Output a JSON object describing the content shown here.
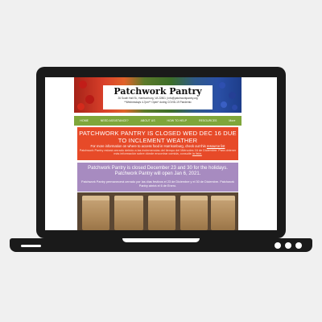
{
  "site": {
    "name": "Patchwork Pantry",
    "address_line": "26 South Hall St., Harrisonburg, VA 22801  |  info@patchworkpantry.org",
    "hours_line": "**Wednesdays 4-7pm**  Open* during COVID-19 Pandemic"
  },
  "nav": {
    "items": [
      "HOME",
      "NEED ASSISTANCE?",
      "ABOUT US",
      "HOW TO HELP",
      "RESOURCES",
      "More"
    ]
  },
  "alert": {
    "headline": "PATCHWORK PANTRY IS CLOSED WED DEC 16 DUE TO INCLEMENT WEATHER",
    "info_text": "For more information on where to access food in Harrisonburg, check out this",
    "info_link": "resource list",
    "spanish_text": "Patchwork Pantry estará cerrado debido a las inclemencias del tiempo del Miércoles 16 de Diciembre. Para obtener más información sobre dónde encontrar comida, consulte",
    "spanish_link": "la lista."
  },
  "holiday": {
    "english": "Patchwork Pantry is closed December 23 and 30 for the holidays. Patchwork Pantry will open Jan 6, 2021.",
    "spanish": "Patchwork Pantry permanecerá cerrado por las días festivos el 23 de Diciembre y el 30 de Diciembre. Patchwork Pantry abrirá el 6 de Enero."
  },
  "colors": {
    "alert_bg": "#e74a28",
    "holiday_bg": "#a78bc0",
    "nav_bg": "#7fa63a",
    "laptop": "#1a1a1a"
  }
}
